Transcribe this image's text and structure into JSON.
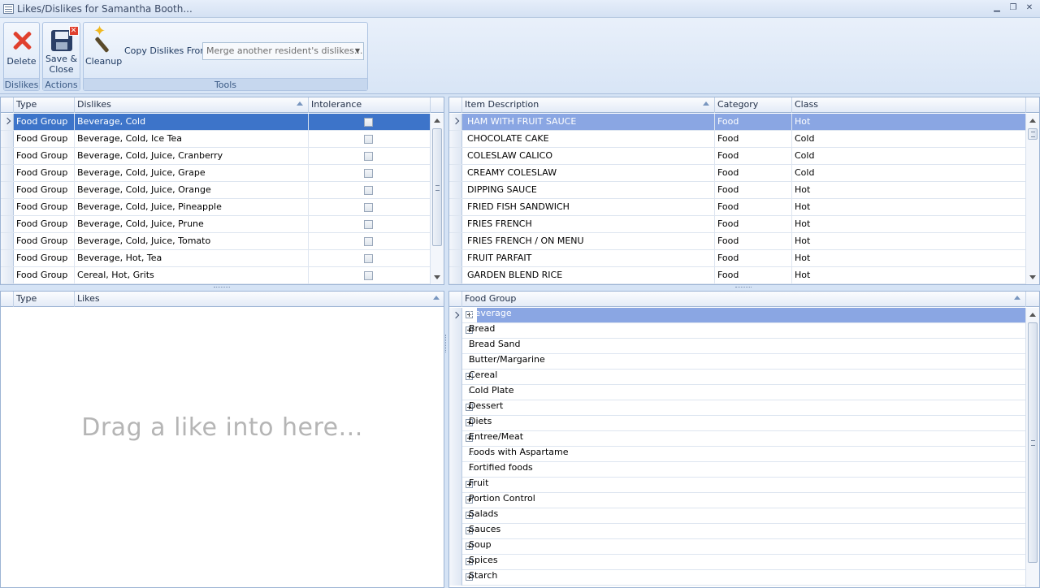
{
  "window": {
    "title": "Likes/Dislikes for Samantha Booth..."
  },
  "ribbon": {
    "groups": {
      "dislikes": "Dislikes",
      "actions": "Actions",
      "tools": "Tools"
    },
    "delete_label": "Delete",
    "save_close_label_1": "Save &",
    "save_close_label_2": "Close",
    "cleanup_label": "Cleanup",
    "copy_dislikes_label": "Copy Dislikes From:",
    "copy_dislikes_placeholder": "Merge another resident's dislikes..."
  },
  "dislikes_grid": {
    "columns": {
      "type": "Type",
      "dislikes": "Dislikes",
      "intolerance": "Intolerance"
    },
    "rows": [
      {
        "type": "Food Group",
        "dislike": "Beverage, Cold",
        "intolerance": false
      },
      {
        "type": "Food Group",
        "dislike": "Beverage, Cold, Ice Tea",
        "intolerance": false
      },
      {
        "type": "Food Group",
        "dislike": "Beverage, Cold, Juice, Cranberry",
        "intolerance": false
      },
      {
        "type": "Food Group",
        "dislike": "Beverage, Cold, Juice, Grape",
        "intolerance": false
      },
      {
        "type": "Food Group",
        "dislike": "Beverage, Cold, Juice, Orange",
        "intolerance": false
      },
      {
        "type": "Food Group",
        "dislike": "Beverage, Cold, Juice, Pineapple",
        "intolerance": false
      },
      {
        "type": "Food Group",
        "dislike": "Beverage, Cold, Juice, Prune",
        "intolerance": false
      },
      {
        "type": "Food Group",
        "dislike": "Beverage, Cold, Juice, Tomato",
        "intolerance": false
      },
      {
        "type": "Food Group",
        "dislike": "Beverage, Hot, Tea",
        "intolerance": false
      },
      {
        "type": "Food Group",
        "dislike": "Cereal, Hot, Grits",
        "intolerance": false
      }
    ]
  },
  "items_grid": {
    "columns": {
      "description": "Item Description",
      "category": "Category",
      "class": "Class"
    },
    "rows": [
      {
        "description": "HAM WITH FRUIT SAUCE",
        "category": "Food",
        "class": "Hot"
      },
      {
        "description": "CHOCOLATE CAKE",
        "category": "Food",
        "class": "Cold"
      },
      {
        "description": "COLESLAW CALICO",
        "category": "Food",
        "class": "Cold"
      },
      {
        "description": "CREAMY COLESLAW",
        "category": "Food",
        "class": "Cold"
      },
      {
        "description": "DIPPING SAUCE",
        "category": "Food",
        "class": "Hot"
      },
      {
        "description": "FRIED FISH SANDWICH",
        "category": "Food",
        "class": "Hot"
      },
      {
        "description": "FRIES FRENCH",
        "category": "Food",
        "class": "Hot"
      },
      {
        "description": "FRIES FRENCH / ON MENU",
        "category": "Food",
        "class": "Hot"
      },
      {
        "description": "FRUIT PARFAIT",
        "category": "Food",
        "class": "Hot"
      },
      {
        "description": "GARDEN BLEND RICE",
        "category": "Food",
        "class": "Hot"
      }
    ]
  },
  "likes_grid": {
    "columns": {
      "type": "Type",
      "likes": "Likes"
    },
    "empty_text": "Drag a like into here..."
  },
  "food_group_tree": {
    "column": "Food Group",
    "items": [
      {
        "label": "Beverage",
        "expandable": true
      },
      {
        "label": "Bread",
        "expandable": true
      },
      {
        "label": "Bread Sand",
        "expandable": false
      },
      {
        "label": "Butter/Margarine",
        "expandable": false
      },
      {
        "label": "Cereal",
        "expandable": true
      },
      {
        "label": "Cold Plate",
        "expandable": false
      },
      {
        "label": "Dessert",
        "expandable": true
      },
      {
        "label": "Diets",
        "expandable": true
      },
      {
        "label": "Entree/Meat",
        "expandable": true
      },
      {
        "label": "Foods with Aspartame",
        "expandable": false
      },
      {
        "label": "Fortified foods",
        "expandable": false
      },
      {
        "label": "Fruit",
        "expandable": true
      },
      {
        "label": "Portion Control",
        "expandable": true
      },
      {
        "label": "Salads",
        "expandable": true
      },
      {
        "label": "Sauces",
        "expandable": true
      },
      {
        "label": "Soup",
        "expandable": true
      },
      {
        "label": "Spices",
        "expandable": true
      },
      {
        "label": "Starch",
        "expandable": true
      }
    ]
  }
}
